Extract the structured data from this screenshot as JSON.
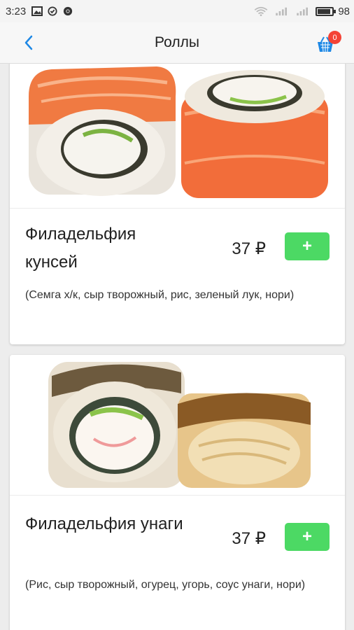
{
  "statusbar": {
    "time": "3:23",
    "battery": "98",
    "battery_level": 0.98,
    "icons": [
      "image-icon",
      "check-circle-icon",
      "chrome-icon",
      "wifi-icon",
      "signal-icon",
      "signal-icon",
      "battery-icon"
    ]
  },
  "appbar": {
    "title": "Роллы",
    "cart_count": "0"
  },
  "products": [
    {
      "name": "Филадельфия кунсей",
      "price": "37 ₽",
      "add_label": "+",
      "description": "(Семга х/к, сыр творожный, рис, зеленый лук, нори)"
    },
    {
      "name": "Филадельфия унаги",
      "price": "37 ₽",
      "add_label": "+",
      "description": "(Рис, сыр творожный, огурец, угорь, соус унаги, нори)"
    }
  ],
  "colors": {
    "accent_blue": "#1e88e5",
    "add_green": "#4cd964",
    "badge_red": "#f44336"
  }
}
